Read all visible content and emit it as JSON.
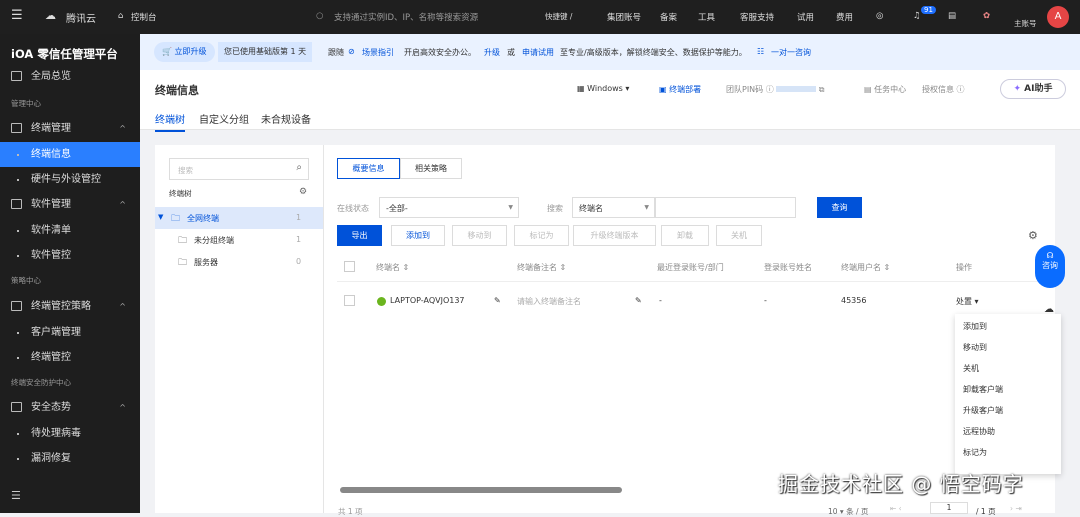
{
  "topbar": {
    "brand": "腾讯云",
    "console": "控制台",
    "search_placeholder": "支持通过实例ID、IP、名称等搜索资源",
    "shortcut": "快捷键 /",
    "nav": [
      "集团账号",
      "备案",
      "工具",
      "客服支持",
      "试用",
      "费用"
    ],
    "notif_count": "91",
    "account": "主账号",
    "avatar": "A"
  },
  "sidebar": {
    "title": "iOA 零信任管理平台",
    "items": [
      {
        "type": "grp",
        "label": "全局总览"
      },
      {
        "type": "sec",
        "label": "管理中心"
      },
      {
        "type": "grp",
        "label": "终端管理",
        "caret": "^"
      },
      {
        "type": "sub",
        "label": "终端信息",
        "active": true
      },
      {
        "type": "sub",
        "label": "硬件与外设管控"
      },
      {
        "type": "grp",
        "label": "软件管理",
        "caret": "^"
      },
      {
        "type": "sub",
        "label": "软件清单"
      },
      {
        "type": "sub",
        "label": "软件管控"
      },
      {
        "type": "sec",
        "label": "策略中心"
      },
      {
        "type": "grp",
        "label": "终端管控策略",
        "caret": "^"
      },
      {
        "type": "sub",
        "label": "客户端管理"
      },
      {
        "type": "sub",
        "label": "终端管控"
      },
      {
        "type": "sec",
        "label": "终端安全防护中心"
      },
      {
        "type": "grp",
        "label": "安全态势",
        "caret": "^"
      },
      {
        "type": "sub",
        "label": "待处理病毒"
      },
      {
        "type": "sub",
        "label": "漏洞修复"
      }
    ]
  },
  "banner": {
    "upgrade": "立即升级",
    "days": "您已使用基础版第 1 天",
    "follow": "跟随",
    "guide": "场景指引",
    "text1": "开启高效安全办公。",
    "upgrade_link": "升级",
    "or": "或",
    "trial": "申请试用",
    "text2": "至专业/高级版本，解锁终端安全、数据保护等能力。",
    "consult": "一对一咨询"
  },
  "header": {
    "title": "终端信息",
    "os": "Windows",
    "deploy": "终端部署",
    "pin": "团队PIN码",
    "task": "任务中心",
    "license": "授权信息",
    "ai": "AI助手",
    "tabs": [
      "终端树",
      "自定义分组",
      "未合规设备"
    ]
  },
  "tree": {
    "search_placeholder": "搜索",
    "label": "终端树",
    "nodes": [
      {
        "name": "全网终端",
        "count": "1"
      },
      {
        "name": "未分组终端",
        "count": "1"
      },
      {
        "name": "服务器",
        "count": "0"
      }
    ]
  },
  "main": {
    "subtabs": [
      "概要信息",
      "相关策略"
    ],
    "status_label": "在线状态",
    "status_value": "-全部-",
    "search_label": "搜索",
    "search_field": "终端名",
    "query": "查询",
    "actions": [
      "导出",
      "添加到",
      "移动到",
      "标记为",
      "升级终端版本",
      "卸载",
      "关机"
    ],
    "columns": [
      "终端名 ⇕",
      "终端备注名 ⇕",
      "最近登录账号/部门",
      "登录账号姓名",
      "终端用户名 ⇕",
      "操作"
    ],
    "rows": [
      {
        "name": "LAPTOP-AQVJO137",
        "remark_placeholder": "请输入终端备注名",
        "login": "-",
        "account_name": "-",
        "user": "45356",
        "action": "处置 ▾"
      }
    ],
    "menu": [
      "添加到",
      "移动到",
      "关机",
      "卸载客户端",
      "升级客户端",
      "远程协助",
      "标记为"
    ],
    "total": "共 1 项",
    "page_size": "10 ▾ 条 / 页",
    "page": "1",
    "pages": "/ 1 页"
  },
  "float": {
    "consult": "咨询"
  },
  "watermark": "掘金技术社区 @ 悟空码字"
}
